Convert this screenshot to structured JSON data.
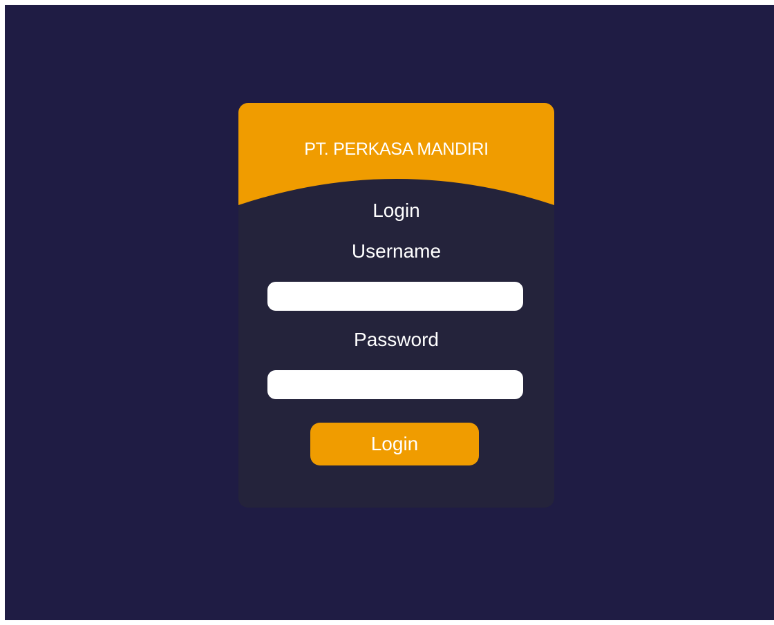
{
  "header": {
    "company_name": "PT. PERKASA MANDIRI"
  },
  "login_form": {
    "title": "Login",
    "username_label": "Username",
    "username_value": "",
    "password_label": "Password",
    "password_value": "",
    "submit_label": "Login"
  },
  "colors": {
    "background": "#1f1c44",
    "card": "#24233b",
    "accent": "#f09c00",
    "input": "#ffffff",
    "text": "#ffffff"
  }
}
